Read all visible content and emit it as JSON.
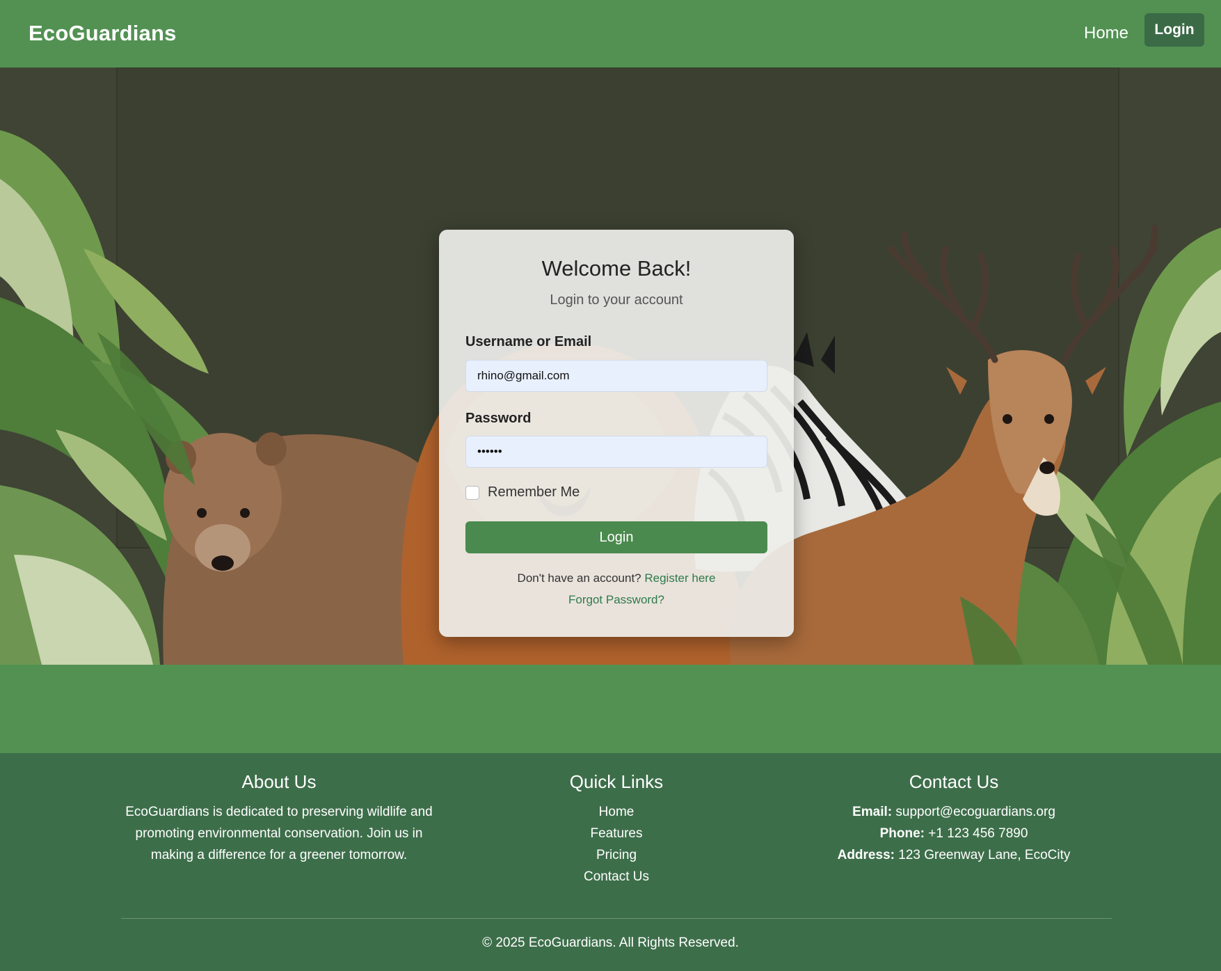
{
  "header": {
    "brand": "EcoGuardians",
    "nav": {
      "home": "Home",
      "login": "Login"
    }
  },
  "login_card": {
    "title": "Welcome Back!",
    "subtitle": "Login to your account",
    "username_label": "Username or Email",
    "username_value": "rhino@gmail.com",
    "password_label": "Password",
    "password_value": "••••••",
    "remember_label": "Remember Me",
    "remember_checked": false,
    "login_button": "Login",
    "register_prompt": "Don't have an account?",
    "register_link": "Register here",
    "forgot_link": "Forgot Password?"
  },
  "footer": {
    "about": {
      "title": "About Us",
      "text": "EcoGuardians is dedicated to preserving wildlife and promoting environmental conservation. Join us in making a difference for a greener tomorrow."
    },
    "quick_links": {
      "title": "Quick Links",
      "items": [
        "Home",
        "Features",
        "Pricing",
        "Contact Us"
      ]
    },
    "contact": {
      "title": "Contact Us",
      "email_label": "Email:",
      "email": "support@ecoguardians.org",
      "phone_label": "Phone:",
      "phone": "+1 123 456 7890",
      "address_label": "Address:",
      "address": "123 Greenway Lane, EcoCity"
    },
    "copyright": "© 2025 EcoGuardians. All Rights Reserved."
  },
  "colors": {
    "header_green": "#529152",
    "footer_green": "#3d6e4a",
    "hero_bg": "#3f4434",
    "button_green": "#4b8a4e",
    "link_green": "#2f7a4b"
  },
  "hero_art": [
    "leaves",
    "bear",
    "lion",
    "zebra",
    "deer"
  ]
}
